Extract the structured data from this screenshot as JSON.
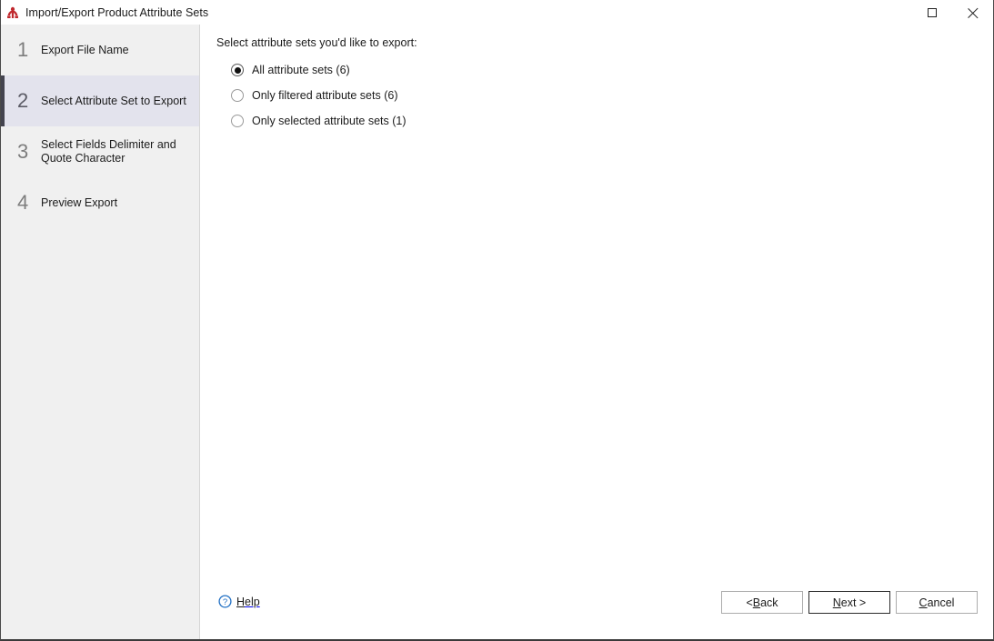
{
  "window": {
    "title": "Import/Export Product Attribute Sets",
    "app_icon": "app-logo-icon",
    "controls": {
      "maximize_label": "Maximize",
      "maximize_icon": "maximize-icon",
      "close_label": "Close",
      "close_icon": "close-icon"
    },
    "colors": {
      "titlebar_bg": "#ffffff",
      "sidebar_bg": "#f0f0f0",
      "sidebar_active_bg": "#e3e3ed",
      "sidebar_active_marker": "#44444f",
      "content_bg": "#ffffff",
      "text": "#1b1b1b",
      "step_number": "#7d7d7d",
      "help_accent": "#1f6fc4",
      "app_icon_accent": "#c0282d"
    }
  },
  "sidebar": {
    "steps": [
      {
        "number": "1",
        "label": "Export File Name",
        "active": false
      },
      {
        "number": "2",
        "label": "Select Attribute Set to Export",
        "active": true
      },
      {
        "number": "3",
        "label": "Select Fields Delimiter and Quote Character",
        "active": false
      },
      {
        "number": "4",
        "label": "Preview Export",
        "active": false
      }
    ]
  },
  "main": {
    "prompt": "Select attribute sets you'd like to export:",
    "options": [
      {
        "label": "All attribute sets (6)",
        "checked": true
      },
      {
        "label": "Only filtered attribute sets (6)",
        "checked": false
      },
      {
        "label": "Only selected attribute sets (1)",
        "checked": false
      }
    ]
  },
  "footer": {
    "help": {
      "icon": "help-circle-icon",
      "mnemonic": "H",
      "rest": "elp"
    },
    "buttons": [
      {
        "name": "back",
        "prefix": "< ",
        "mnemonic": "B",
        "rest": "ack",
        "default": false
      },
      {
        "name": "next",
        "prefix": "",
        "mnemonic": "N",
        "rest": "ext >",
        "default": true
      },
      {
        "name": "cancel",
        "prefix": "",
        "mnemonic": "C",
        "rest": "ancel",
        "default": false
      }
    ]
  }
}
